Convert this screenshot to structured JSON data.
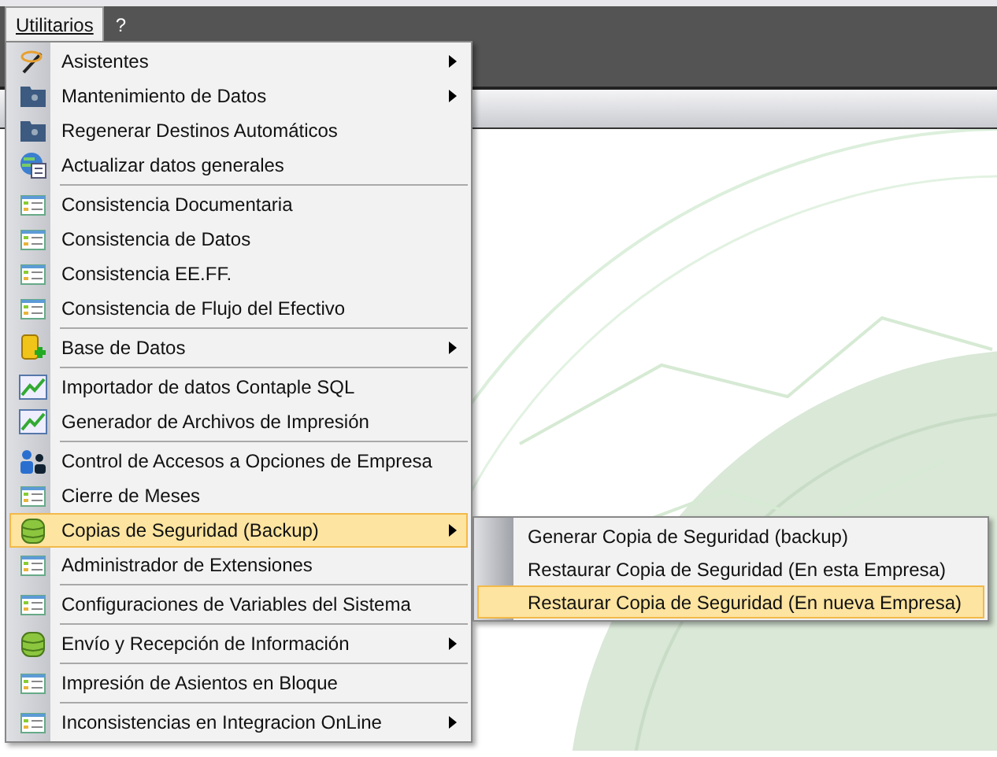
{
  "menubar": [
    {
      "label": "Utilitarios",
      "selected": true
    },
    {
      "label": "?",
      "selected": false
    }
  ],
  "menu": {
    "sections": [
      [
        {
          "label": "Asistentes",
          "kind": "wand",
          "submenu": true,
          "selected": false
        },
        {
          "label": "Mantenimiento de Datos",
          "kind": "folder",
          "submenu": true,
          "selected": false
        },
        {
          "label": "Regenerar Destinos Automáticos",
          "kind": "folder",
          "submenu": false,
          "selected": false
        },
        {
          "label": "Actualizar datos generales",
          "kind": "globe",
          "submenu": false,
          "selected": false
        }
      ],
      [
        {
          "label": "Consistencia Documentaria",
          "kind": "list",
          "submenu": false,
          "selected": false
        },
        {
          "label": "Consistencia de Datos",
          "kind": "list",
          "submenu": false,
          "selected": false
        },
        {
          "label": "Consistencia EE.FF.",
          "kind": "list",
          "submenu": false,
          "selected": false
        },
        {
          "label": "Consistencia de Flujo del Efectivo",
          "kind": "list",
          "submenu": false,
          "selected": false
        }
      ],
      [
        {
          "label": "Base de Datos",
          "kind": "db-add",
          "submenu": true,
          "selected": false
        }
      ],
      [
        {
          "label": "Importador de datos Contaple SQL",
          "kind": "chart",
          "submenu": false,
          "selected": false
        },
        {
          "label": "Generador de Archivos de Impresión",
          "kind": "chart",
          "submenu": false,
          "selected": false
        }
      ],
      [
        {
          "label": "Control de Accesos a Opciones de Empresa",
          "kind": "users",
          "submenu": false,
          "selected": false
        },
        {
          "label": "Cierre de Meses",
          "kind": "list",
          "submenu": false,
          "selected": false
        },
        {
          "label": "Copias de Seguridad (Backup)",
          "kind": "db",
          "submenu": true,
          "selected": true
        },
        {
          "label": "Administrador de Extensiones",
          "kind": "list",
          "submenu": false,
          "selected": false
        }
      ],
      [
        {
          "label": "Configuraciones de Variables del Sistema",
          "kind": "list",
          "submenu": false,
          "selected": false
        }
      ],
      [
        {
          "label": "Envío y Recepción de Información",
          "kind": "db",
          "submenu": true,
          "selected": false
        }
      ],
      [
        {
          "label": "Impresión de Asientos en Bloque",
          "kind": "list",
          "submenu": false,
          "selected": false
        }
      ],
      [
        {
          "label": "Inconsistencias en Integracion OnLine",
          "kind": "list",
          "submenu": true,
          "selected": false
        }
      ]
    ]
  },
  "submenu": {
    "items": [
      {
        "label": "Generar Copia de Seguridad (backup)",
        "selected": false
      },
      {
        "label": "Restaurar Copia de Seguridad (En esta Empresa)",
        "selected": false
      },
      {
        "label": "Restaurar Copia de Seguridad (En nueva Empresa)",
        "selected": true
      }
    ]
  }
}
